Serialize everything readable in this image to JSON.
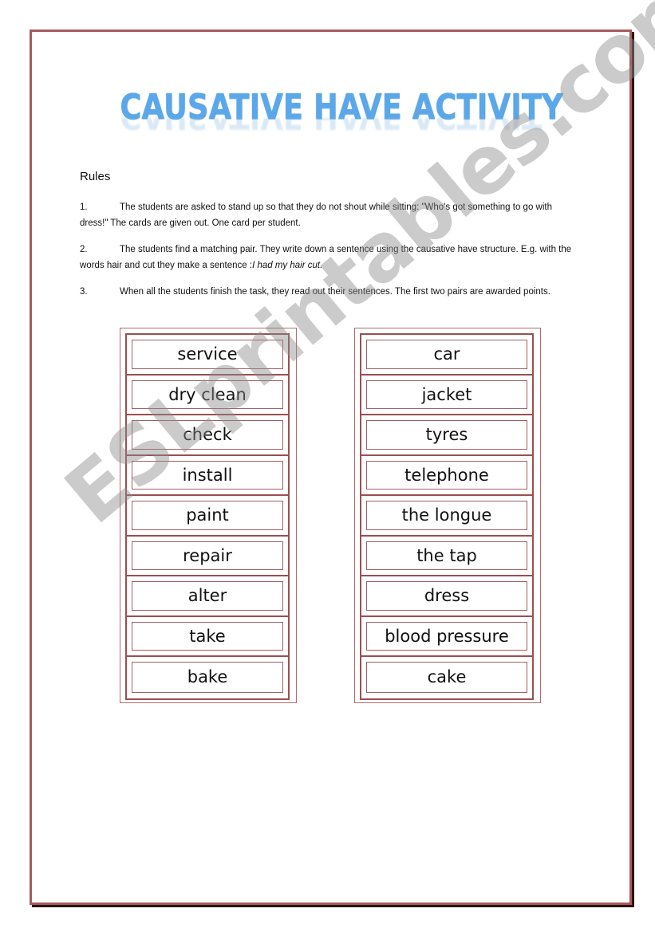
{
  "title": "CAUSATIVE HAVE ACTIVITY",
  "rules": {
    "heading": "Rules",
    "items": [
      {
        "num": "1.",
        "text": "The students are asked to stand up so that they do not shout while sitting: \"Who's got something to go with dress!\" The cards are given out. One card per student."
      },
      {
        "num": "2.",
        "text": "The students find a matching pair. They write down a sentence using the causative have structure. E.g. with the words hair and cut they make a sentence :",
        "example": "I had my hair cut."
      },
      {
        "num": "3.",
        "text": "When all the students finish the task, they read out their sentences. The first two pairs are awarded points."
      }
    ]
  },
  "cards": {
    "verbs": [
      "service",
      "dry clean",
      "check",
      "install",
      "paint",
      "repair",
      "alter",
      "take",
      "bake"
    ],
    "nouns": [
      "car",
      "jacket",
      "tyres",
      "telephone",
      "the longue",
      "the tap",
      "dress",
      "blood pressure",
      "cake"
    ]
  },
  "watermark": "ESLprintables.com",
  "colors": {
    "border": "#a85a5c",
    "title": "#5aa8ea",
    "watermark": "#8c8c8c"
  }
}
